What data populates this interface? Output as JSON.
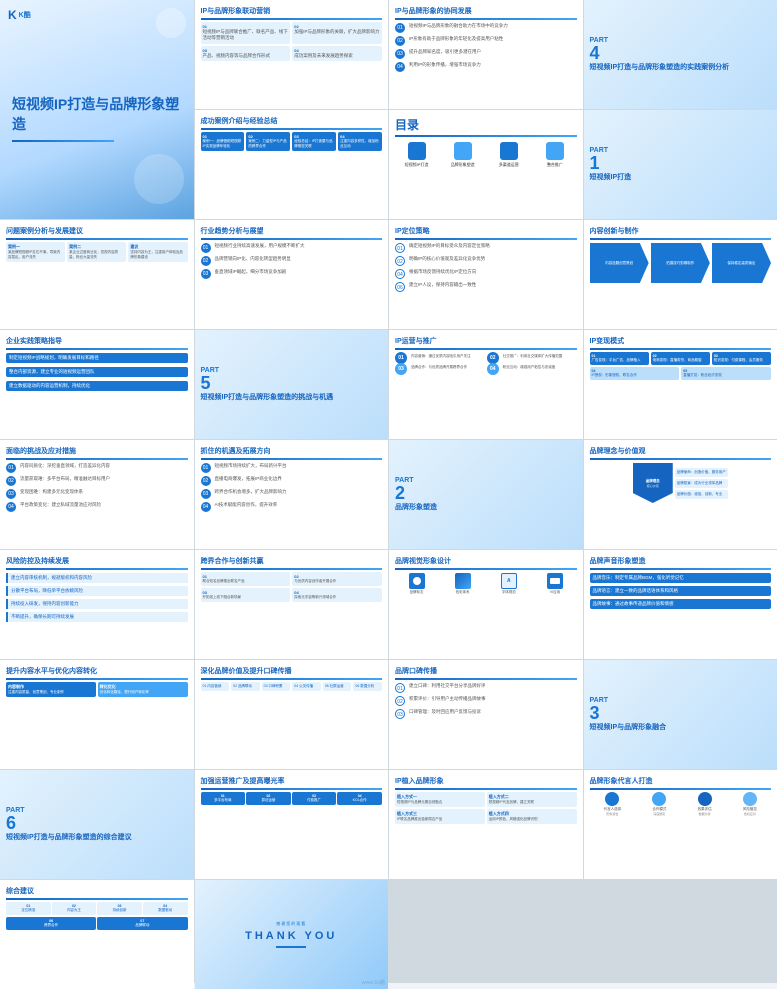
{
  "title": "短视频IP打造与品牌形象塑造",
  "subtitle": "短视频IP打造与品牌形象塑造",
  "watermark": "www.1k酷",
  "brand": "K酷",
  "sections": {
    "cover": {
      "title": "短视频IP打造与品牌形象塑造",
      "label": "K酷"
    },
    "toc": {
      "title": "目录",
      "items": [
        "短视频IP打造",
        "品牌形象塑造",
        "多渠道运营",
        "整合推广"
      ]
    },
    "part1": {
      "num": "1",
      "label": "PART",
      "title": "短视频IP打造"
    },
    "part2": {
      "num": "2",
      "label": "PART",
      "title": "品牌形象塑造"
    },
    "part3": {
      "num": "3",
      "label": "PART",
      "title": "短视频IP与品牌形象融合"
    },
    "part4": {
      "num": "4",
      "label": "PART",
      "title": "短视频IP打造与品牌形象塑造的实践案例分析"
    },
    "part5": {
      "num": "5",
      "label": "PART",
      "title": "短视频IP打造与品牌形象塑造的挑战与机遇"
    },
    "part6": {
      "num": "6",
      "label": "PART",
      "title": "短视频IP打造与品牌形象塑造的综合建议"
    },
    "ip_strategy": "IP定位策略",
    "content_innovation": "内容创新与制作",
    "ip_operation": "IP运营与推广",
    "ip_realization": "IP变现模式",
    "brand_concept": "品牌理念与价值观",
    "brand_voice": "品牌声音形象塑造",
    "brand_visual": "品牌视觉形象设计",
    "brand_ambassador": "品牌形象代言人打造",
    "brand_oral": "品牌口碑传播",
    "ip_embed": "IP植入品牌形象",
    "ip_brand_joint": "IP与品牌形象联动营销",
    "ip_brand_synergy": "IP与品牌形象的协同发展",
    "case_analysis": "成功案例介绍与经验总结",
    "problem_analysis": "问题案例分析与发展建议",
    "industry_trend": "行业趋势分析与展望",
    "enterprise_guide": "企业实践策略指导",
    "challenge_response": "面临的挑战及应对措施",
    "opportunity": "抓住的机遇及拓展方向",
    "risk_control": "风险防控及持续发展",
    "cross_boundary": "跨界合作与创新共赢",
    "comprehensive_advice": "综合建议",
    "strengthen_operation": "加强运营推广及提高曝光率",
    "deepen_brand": "深化品牌价值及提升口碑传播",
    "enhance_content": "提升内容水平与优化内容转化",
    "thank_you": "THANK YOU"
  }
}
